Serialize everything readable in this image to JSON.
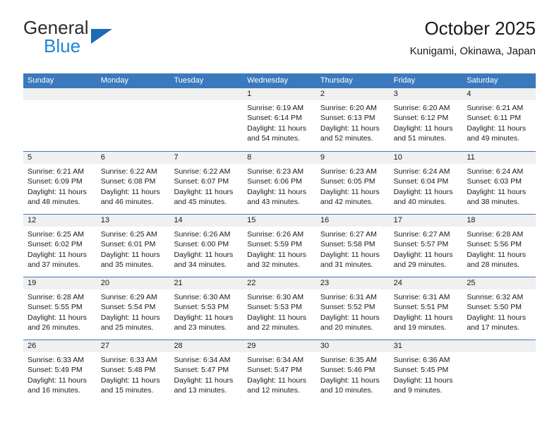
{
  "brand": {
    "name_top": "General",
    "name_bottom": "Blue",
    "triangle_color": "#1c6cb5",
    "blue_text_color": "#1f84d6"
  },
  "header": {
    "title": "October 2025",
    "subtitle": "Kunigami, Okinawa, Japan"
  },
  "theme": {
    "header_blue": "#3b79bd",
    "daynum_band": "#f0f0f0",
    "text": "#1a1a1a"
  },
  "weekday_headers": [
    "Sunday",
    "Monday",
    "Tuesday",
    "Wednesday",
    "Thursday",
    "Friday",
    "Saturday"
  ],
  "weeks": [
    [
      {
        "day": "",
        "lines": [
          "",
          "",
          "",
          ""
        ]
      },
      {
        "day": "",
        "lines": [
          "",
          "",
          "",
          ""
        ]
      },
      {
        "day": "",
        "lines": [
          "",
          "",
          "",
          ""
        ]
      },
      {
        "day": "1",
        "lines": [
          "Sunrise: 6:19 AM",
          "Sunset: 6:14 PM",
          "Daylight: 11 hours",
          "and 54 minutes."
        ]
      },
      {
        "day": "2",
        "lines": [
          "Sunrise: 6:20 AM",
          "Sunset: 6:13 PM",
          "Daylight: 11 hours",
          "and 52 minutes."
        ]
      },
      {
        "day": "3",
        "lines": [
          "Sunrise: 6:20 AM",
          "Sunset: 6:12 PM",
          "Daylight: 11 hours",
          "and 51 minutes."
        ]
      },
      {
        "day": "4",
        "lines": [
          "Sunrise: 6:21 AM",
          "Sunset: 6:11 PM",
          "Daylight: 11 hours",
          "and 49 minutes."
        ]
      }
    ],
    [
      {
        "day": "5",
        "lines": [
          "Sunrise: 6:21 AM",
          "Sunset: 6:09 PM",
          "Daylight: 11 hours",
          "and 48 minutes."
        ]
      },
      {
        "day": "6",
        "lines": [
          "Sunrise: 6:22 AM",
          "Sunset: 6:08 PM",
          "Daylight: 11 hours",
          "and 46 minutes."
        ]
      },
      {
        "day": "7",
        "lines": [
          "Sunrise: 6:22 AM",
          "Sunset: 6:07 PM",
          "Daylight: 11 hours",
          "and 45 minutes."
        ]
      },
      {
        "day": "8",
        "lines": [
          "Sunrise: 6:23 AM",
          "Sunset: 6:06 PM",
          "Daylight: 11 hours",
          "and 43 minutes."
        ]
      },
      {
        "day": "9",
        "lines": [
          "Sunrise: 6:23 AM",
          "Sunset: 6:05 PM",
          "Daylight: 11 hours",
          "and 42 minutes."
        ]
      },
      {
        "day": "10",
        "lines": [
          "Sunrise: 6:24 AM",
          "Sunset: 6:04 PM",
          "Daylight: 11 hours",
          "and 40 minutes."
        ]
      },
      {
        "day": "11",
        "lines": [
          "Sunrise: 6:24 AM",
          "Sunset: 6:03 PM",
          "Daylight: 11 hours",
          "and 38 minutes."
        ]
      }
    ],
    [
      {
        "day": "12",
        "lines": [
          "Sunrise: 6:25 AM",
          "Sunset: 6:02 PM",
          "Daylight: 11 hours",
          "and 37 minutes."
        ]
      },
      {
        "day": "13",
        "lines": [
          "Sunrise: 6:25 AM",
          "Sunset: 6:01 PM",
          "Daylight: 11 hours",
          "and 35 minutes."
        ]
      },
      {
        "day": "14",
        "lines": [
          "Sunrise: 6:26 AM",
          "Sunset: 6:00 PM",
          "Daylight: 11 hours",
          "and 34 minutes."
        ]
      },
      {
        "day": "15",
        "lines": [
          "Sunrise: 6:26 AM",
          "Sunset: 5:59 PM",
          "Daylight: 11 hours",
          "and 32 minutes."
        ]
      },
      {
        "day": "16",
        "lines": [
          "Sunrise: 6:27 AM",
          "Sunset: 5:58 PM",
          "Daylight: 11 hours",
          "and 31 minutes."
        ]
      },
      {
        "day": "17",
        "lines": [
          "Sunrise: 6:27 AM",
          "Sunset: 5:57 PM",
          "Daylight: 11 hours",
          "and 29 minutes."
        ]
      },
      {
        "day": "18",
        "lines": [
          "Sunrise: 6:28 AM",
          "Sunset: 5:56 PM",
          "Daylight: 11 hours",
          "and 28 minutes."
        ]
      }
    ],
    [
      {
        "day": "19",
        "lines": [
          "Sunrise: 6:28 AM",
          "Sunset: 5:55 PM",
          "Daylight: 11 hours",
          "and 26 minutes."
        ]
      },
      {
        "day": "20",
        "lines": [
          "Sunrise: 6:29 AM",
          "Sunset: 5:54 PM",
          "Daylight: 11 hours",
          "and 25 minutes."
        ]
      },
      {
        "day": "21",
        "lines": [
          "Sunrise: 6:30 AM",
          "Sunset: 5:53 PM",
          "Daylight: 11 hours",
          "and 23 minutes."
        ]
      },
      {
        "day": "22",
        "lines": [
          "Sunrise: 6:30 AM",
          "Sunset: 5:53 PM",
          "Daylight: 11 hours",
          "and 22 minutes."
        ]
      },
      {
        "day": "23",
        "lines": [
          "Sunrise: 6:31 AM",
          "Sunset: 5:52 PM",
          "Daylight: 11 hours",
          "and 20 minutes."
        ]
      },
      {
        "day": "24",
        "lines": [
          "Sunrise: 6:31 AM",
          "Sunset: 5:51 PM",
          "Daylight: 11 hours",
          "and 19 minutes."
        ]
      },
      {
        "day": "25",
        "lines": [
          "Sunrise: 6:32 AM",
          "Sunset: 5:50 PM",
          "Daylight: 11 hours",
          "and 17 minutes."
        ]
      }
    ],
    [
      {
        "day": "26",
        "lines": [
          "Sunrise: 6:33 AM",
          "Sunset: 5:49 PM",
          "Daylight: 11 hours",
          "and 16 minutes."
        ]
      },
      {
        "day": "27",
        "lines": [
          "Sunrise: 6:33 AM",
          "Sunset: 5:48 PM",
          "Daylight: 11 hours",
          "and 15 minutes."
        ]
      },
      {
        "day": "28",
        "lines": [
          "Sunrise: 6:34 AM",
          "Sunset: 5:47 PM",
          "Daylight: 11 hours",
          "and 13 minutes."
        ]
      },
      {
        "day": "29",
        "lines": [
          "Sunrise: 6:34 AM",
          "Sunset: 5:47 PM",
          "Daylight: 11 hours",
          "and 12 minutes."
        ]
      },
      {
        "day": "30",
        "lines": [
          "Sunrise: 6:35 AM",
          "Sunset: 5:46 PM",
          "Daylight: 11 hours",
          "and 10 minutes."
        ]
      },
      {
        "day": "31",
        "lines": [
          "Sunrise: 6:36 AM",
          "Sunset: 5:45 PM",
          "Daylight: 11 hours",
          "and 9 minutes."
        ]
      },
      {
        "day": "",
        "lines": [
          "",
          "",
          "",
          ""
        ]
      }
    ]
  ]
}
